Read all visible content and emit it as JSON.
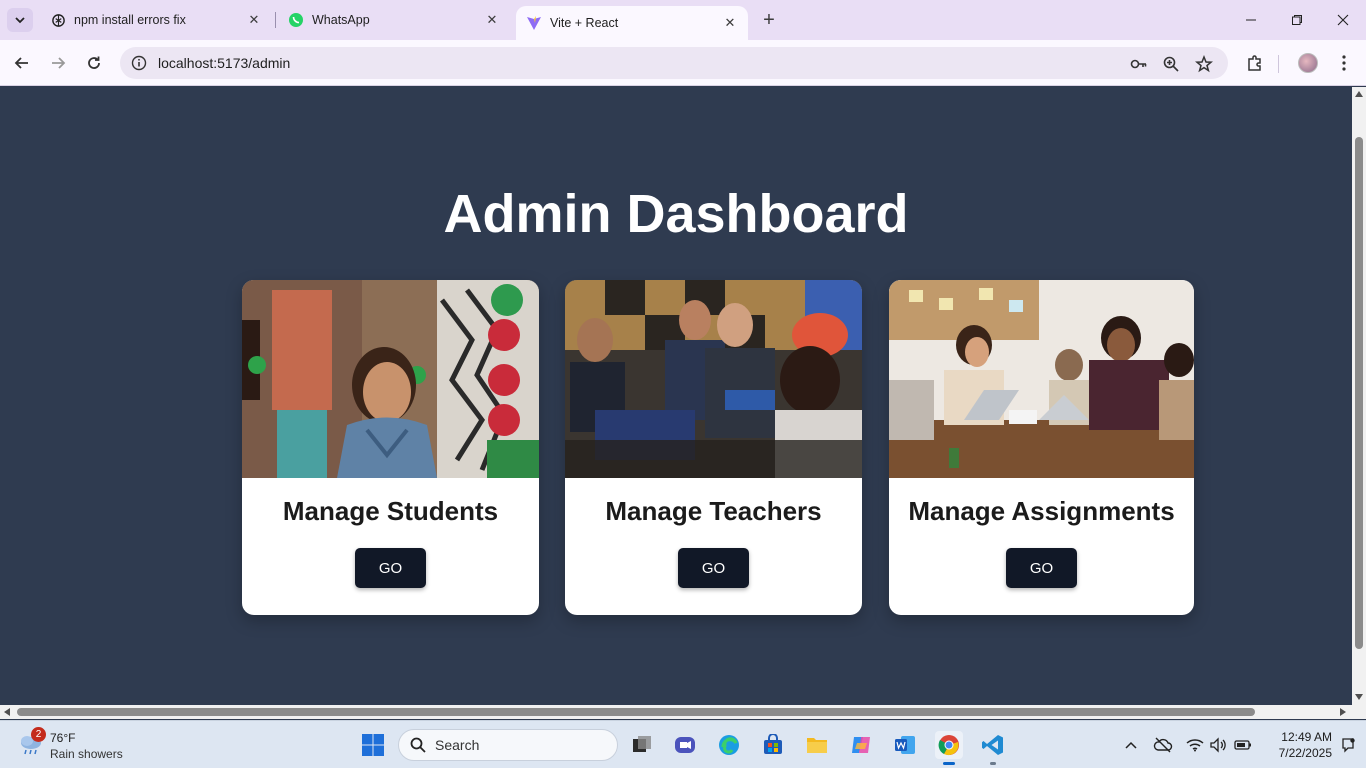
{
  "browser": {
    "tabs": [
      {
        "label": "npm install errors fix",
        "icon": "openai-icon"
      },
      {
        "label": "WhatsApp",
        "icon": "whatsapp-icon"
      },
      {
        "label": "Vite + React",
        "icon": "vite-icon",
        "active": true
      }
    ],
    "url": "localhost:5173/admin"
  },
  "page": {
    "title": "Admin Dashboard",
    "cards": [
      {
        "title": "Manage Students",
        "button": "GO",
        "image": "student-photo"
      },
      {
        "title": "Manage Teachers",
        "button": "GO",
        "image": "teachers-photo"
      },
      {
        "title": "Manage Assignments",
        "button": "GO",
        "image": "assignments-photo"
      }
    ]
  },
  "taskbar": {
    "weather": {
      "temp": "76°F",
      "condition": "Rain showers",
      "badge": "2"
    },
    "search_placeholder": "Search",
    "time": "12:49 AM",
    "date": "7/22/2025"
  },
  "colors": {
    "page_bg": "#2f3b50",
    "button_bg": "#111827",
    "tab_strip": "#e9def5"
  }
}
